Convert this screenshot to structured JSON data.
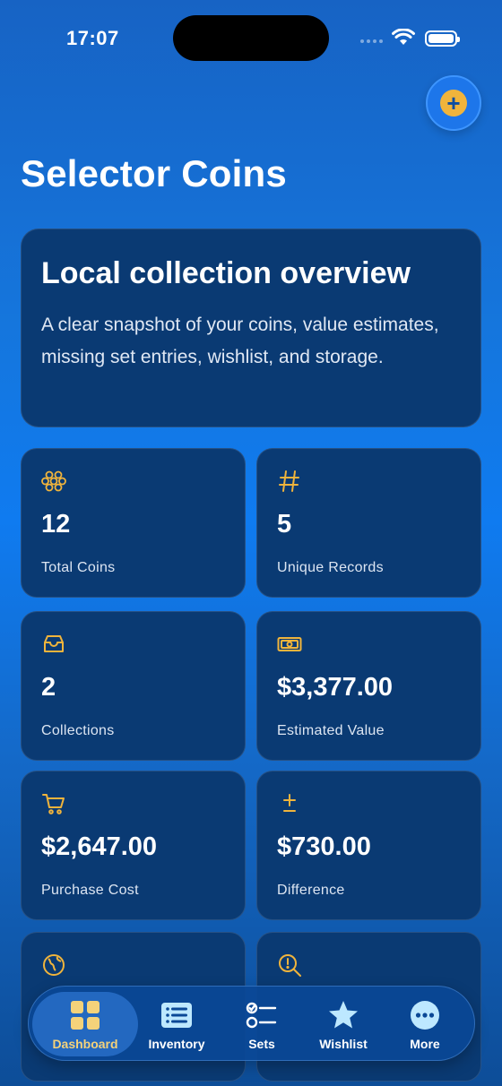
{
  "status_bar": {
    "time": "17:07"
  },
  "header": {
    "title": "Selector Coins"
  },
  "overview": {
    "title": "Local collection overview",
    "description": "A clear snapshot of your coins, value estimates, missing set entries, wishlist, and storage."
  },
  "stats": [
    {
      "icon": "coins-icon",
      "value": "12",
      "label": "Total Coins"
    },
    {
      "icon": "hash-icon",
      "value": "5",
      "label": "Unique Records"
    },
    {
      "icon": "tray-icon",
      "value": "2",
      "label": "Collections"
    },
    {
      "icon": "banknote-icon",
      "value": "$3,377.00",
      "label": "Estimated Value"
    },
    {
      "icon": "cart-icon",
      "value": "$2,647.00",
      "label": "Purchase Cost"
    },
    {
      "icon": "plus-minus-icon",
      "value": "$730.00",
      "label": "Difference"
    },
    {
      "icon": "globe-icon",
      "value": "",
      "label": ""
    },
    {
      "icon": "magnifier-alert-icon",
      "value": "",
      "label": ""
    }
  ],
  "tab_bar": {
    "active": "Dashboard",
    "items": [
      {
        "label": "Dashboard",
        "icon": "grid-icon"
      },
      {
        "label": "Inventory",
        "icon": "list-icon"
      },
      {
        "label": "Sets",
        "icon": "checklist-icon"
      },
      {
        "label": "Wishlist",
        "icon": "star-icon"
      },
      {
        "label": "More",
        "icon": "more-icon"
      }
    ]
  },
  "colors": {
    "accent": "#f0b43c",
    "card": "#0a3a73",
    "background": "#1576dd"
  }
}
